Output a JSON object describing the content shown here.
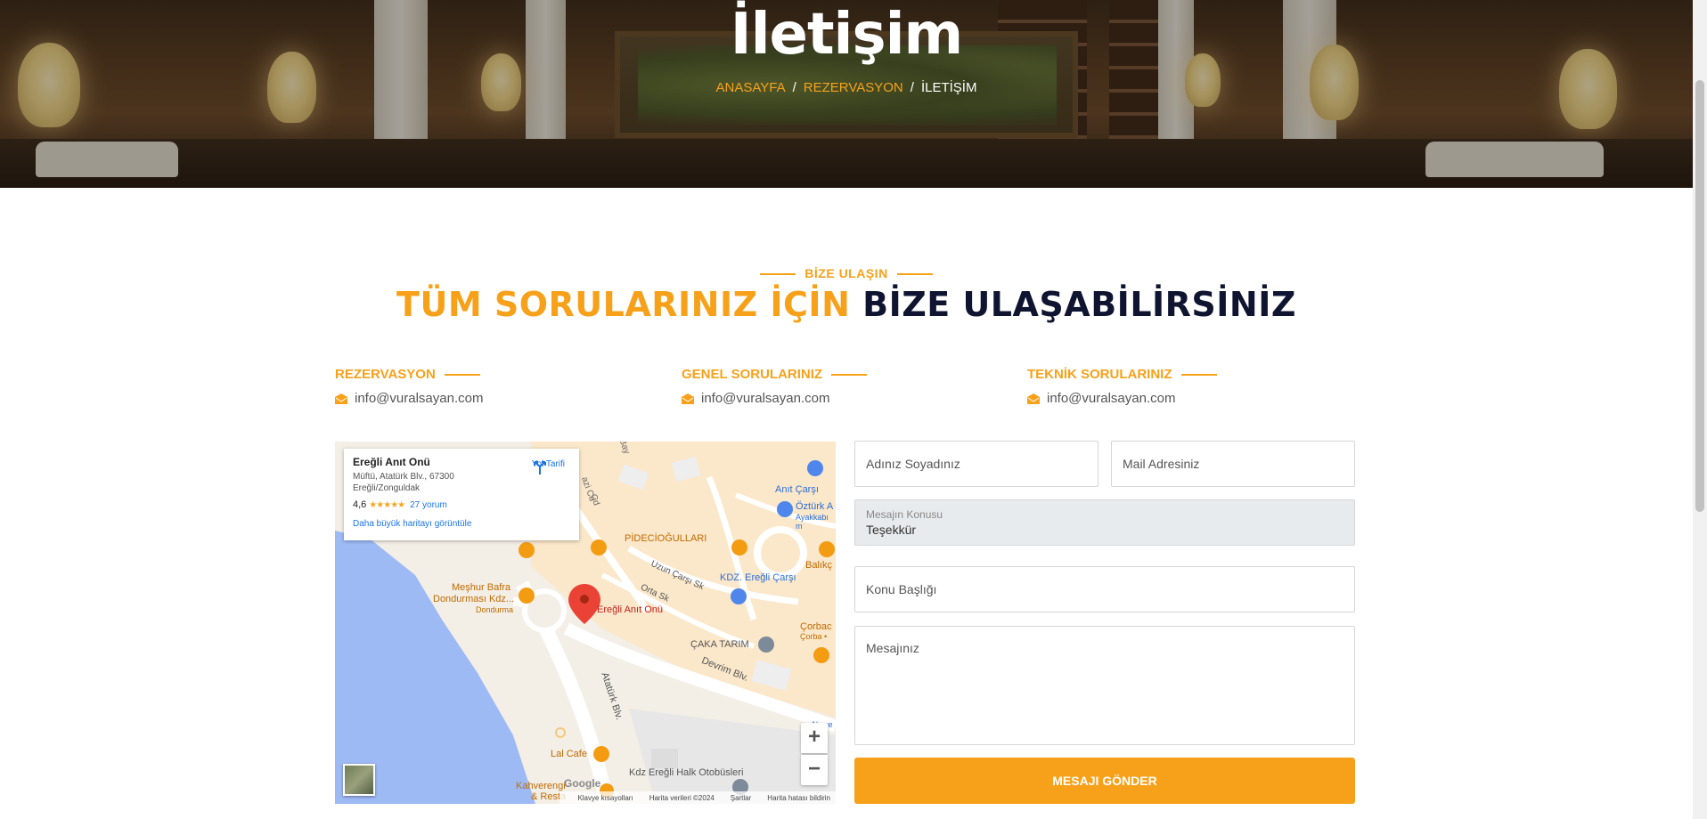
{
  "hero": {
    "title": "İletişim",
    "breadcrumb": {
      "home": "ANASAYFA",
      "reservation": "REZERVASYON",
      "current": "İLETİŞİM",
      "separator": "/"
    }
  },
  "section": {
    "eyebrow": "BİZE ULAŞIN",
    "heading_accent": "TÜM SORULARINIZ İÇİN",
    "heading_dark": "BİZE ULAŞABİLİRSİNİZ"
  },
  "contacts": [
    {
      "label": "REZERVASYON",
      "email": "info@vuralsayan.com",
      "icon": "envelope-icon"
    },
    {
      "label": "GENEL SORULARINIZ",
      "email": "info@vuralsayan.com",
      "icon": "envelope-icon"
    },
    {
      "label": "TEKNİK SORULARINIZ",
      "email": "info@vuralsayan.com",
      "icon": "envelope-icon"
    }
  ],
  "map": {
    "place_name": "Ereğli Anıt Onü",
    "address_line1": "Müftü, Atatürk Blv., 67300",
    "address_line2": "Ereğli/Zonguldak",
    "rating": "4,6",
    "stars": "★★★★★",
    "reviews": "27 yorum",
    "directions": "Yol Tarifi",
    "view_larger": "Daha büyük haritayı görüntüle",
    "pin_label": "Ereğli Anıt Onü",
    "labels": {
      "pidecioglulari": "PİDECİOĞULLARI",
      "anit_carsi": "Anıt Çarşı",
      "ozturk": "Öztürk A",
      "ozturk_sub": "Ayakkabı m",
      "balik": "Balıkç",
      "meshur_bafra": "Meşhur Bafra",
      "dondurmasi": "Dondurması Kdz...",
      "dondurma": "Dondurma",
      "kdz_eregli_carsi": "KDZ. Ereğli Çarşı",
      "uzun_carsi": "Uzun Çarşı Sk",
      "orta_sk": "Orta Sk",
      "corbaci": "Çorbac",
      "corba": "Çorba •",
      "caka_tarim": "ÇAKA TARIM",
      "devrim": "Devrim Blv.",
      "ataturk": "Atatürk Blv.",
      "lal_cafe": "Lal Cafe",
      "otobus": "Kdz Ereğli Halk Otobüsleri",
      "kahveren": "Kahverengi",
      "resta": "& Resta",
      "alisve": "Alışve",
      "bay": "Bay",
      "cd": "Cd",
      "azi_cd": "azi Cd"
    },
    "zoom_in": "+",
    "zoom_out": "−",
    "google": "Google",
    "footer": {
      "shortcuts": "Klavye kısayolları",
      "data": "Harita verileri ©2024",
      "terms": "Şartlar",
      "report": "Harita hatası bildirin"
    }
  },
  "form": {
    "name_placeholder": "Adınız Soyadınız",
    "email_placeholder": "Mail Adresiniz",
    "subject_label": "Mesajın Konusu",
    "subject_value": "Teşekkür",
    "title_placeholder": "Konu Başlığı",
    "message_placeholder": "Mesajınız",
    "submit_label": "MESAJI GÖNDER"
  },
  "colors": {
    "accent": "#f7a11a",
    "dark_heading": "#0f1430",
    "link_blue": "#1a73e8"
  }
}
